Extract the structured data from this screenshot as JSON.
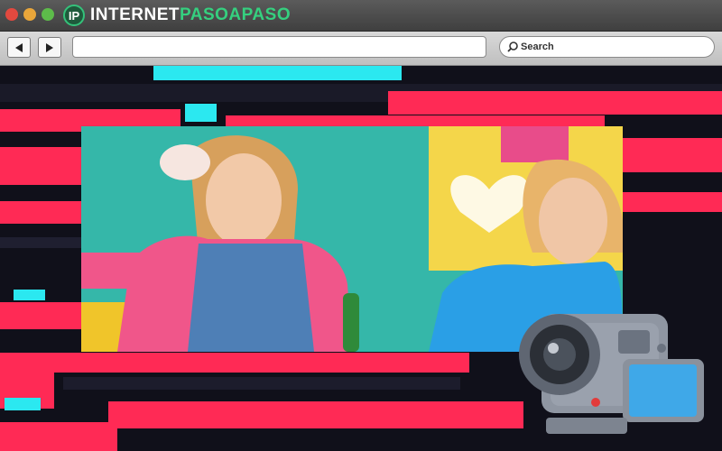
{
  "window": {
    "logo_mark": "IP",
    "logo_text_white": "INTERNET",
    "logo_text_green": "PASOAPASO"
  },
  "toolbar": {
    "url_value": "",
    "search_label": "Search"
  },
  "colors": {
    "accent_pink": "#ff2a55",
    "accent_cyan": "#2be8f0",
    "brand_green": "#35d07f"
  },
  "icons": [
    "back-arrow-icon",
    "forward-arrow-icon",
    "magnifier-icon",
    "video-camera-icon"
  ]
}
